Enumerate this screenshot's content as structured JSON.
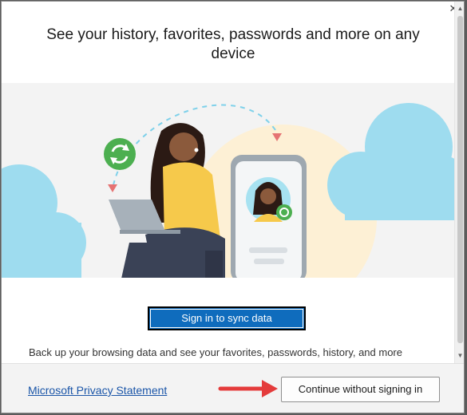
{
  "dialog": {
    "heading": "See your history, favorites, passwords and more on any device",
    "close_icon": "close-icon",
    "sign_in_button": "Sign in to sync data",
    "description": "Back up your browsing data and see your favorites, passwords, history, and more",
    "privacy_link": "Microsoft Privacy Statement",
    "continue_button": "Continue without signing in"
  },
  "colors": {
    "accent": "#0f6cbd",
    "link": "#1a55a8",
    "sync_green": "#4caf50",
    "cloud_blue": "#9edcef",
    "arrow_red": "#e43b3b"
  }
}
